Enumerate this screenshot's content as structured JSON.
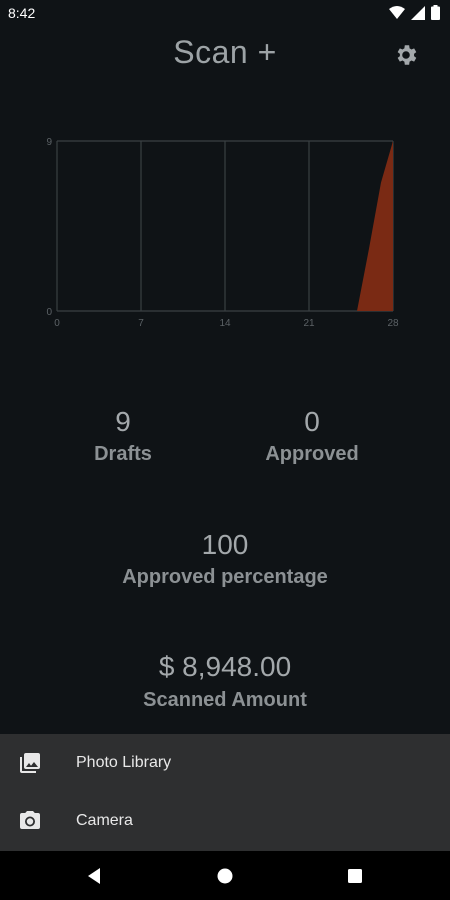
{
  "status_bar": {
    "time": "8:42",
    "icons": [
      "wifi-icon",
      "signal-icon",
      "battery-icon"
    ]
  },
  "header": {
    "title": "Scan +",
    "settings_icon": "gear-icon"
  },
  "chart_data": {
    "type": "area",
    "x_ticks": [
      0,
      7,
      14,
      21,
      28
    ],
    "y_ticks": [
      0,
      9
    ],
    "xlim": [
      0,
      28
    ],
    "ylim": [
      0,
      9
    ],
    "grid": true,
    "series": [
      {
        "x": [
          0,
          25,
          26,
          27,
          28
        ],
        "y": [
          0,
          0,
          3.3,
          6.8,
          9
        ],
        "color": "#7a2a14"
      }
    ]
  },
  "stats": {
    "drafts": {
      "value": "9",
      "label": "Drafts"
    },
    "approved": {
      "value": "0",
      "label": "Approved"
    },
    "approved_percentage": {
      "value": "100",
      "label": "Approved percentage"
    },
    "scanned_amount": {
      "value": "$ 8,948.00",
      "label": "Scanned Amount"
    }
  },
  "bottom_sheet": {
    "items": [
      {
        "label": "Photo Library",
        "icon": "photo-library-icon"
      },
      {
        "label": "Camera",
        "icon": "camera-icon"
      }
    ]
  },
  "nav_bar": {
    "buttons": [
      "back-icon",
      "home-icon",
      "recents-icon"
    ]
  }
}
